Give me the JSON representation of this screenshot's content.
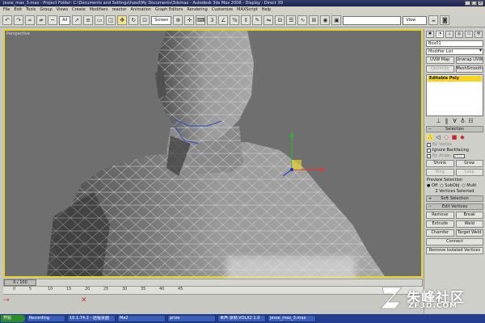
{
  "title": {
    "text": "jesse_max_3.max  - Project Folder: C:\\Documents and Settings\\hasd\\My Documents\\3dsmax  - Autodesk 3ds Max 2008  - Display : Direct 3D"
  },
  "menu": [
    "File",
    "Edit",
    "Tools",
    "Group",
    "Views",
    "Create",
    "Modifiers",
    "reactor",
    "Animation",
    "Graph Editors",
    "Rendering",
    "Customize",
    "MAXScript",
    "Help"
  ],
  "toolbar": {
    "filter_value": "All",
    "refcoord_value": "Screen",
    "view_value": "View"
  },
  "viewport": {
    "label": "Perspective"
  },
  "panel": {
    "object_name": "Box01",
    "modifier_list": "Modifier List",
    "btn_uvw_map": "UVW Map",
    "btn_unwrap_uvw": "Unwrap UVW",
    "btn_optimize": "Optimize",
    "btn_meshsmooth": "MeshSmooth",
    "stack_item": "Editable Poly",
    "rollout_selection": "Selection",
    "chk_by_vertex": "By Vertex",
    "chk_ignore_backfacing": "Ignore Backfacing",
    "chk_by_angle": "By Angle:",
    "angle_value": "45.0",
    "btn_shrink": "Shrink",
    "btn_grow": "Grow",
    "btn_ring": "Ring",
    "btn_loop": "Loop",
    "preview_label": "Preview Selection",
    "radio_off": "Off",
    "radio_subobj": "SubObj",
    "radio_multi": "Multi",
    "selected_status": "2 Vertices Selected",
    "rollout_soft": "Soft Selection",
    "rollout_edit": "Edit Vertices",
    "btn_remove": "Remove",
    "btn_break": "Break",
    "btn_extrude": "Extrude",
    "btn_weld": "Weld",
    "btn_chamfer": "Chamfer",
    "btn_target_weld": "Target Weld",
    "btn_connect": "Connect",
    "btn_remove_isolated": "Remove Isolated Vertices"
  },
  "timeline": {
    "frame": "0 / 100",
    "ticks": [
      "0",
      "5",
      "10",
      "15",
      "20",
      "25",
      "30",
      "35",
      "40",
      "45"
    ]
  },
  "taskbar": {
    "start": "开始",
    "tasks": [
      "Recording",
      "10.1.74.2 - 远程桌面",
      "Ma2",
      "prize",
      "世声.录制.VOLX2 1.0",
      "jesse_max_3.max"
    ]
  },
  "watermark": {
    "title": "朱峰社区",
    "sub": "ZF3D.COM"
  },
  "colors": {
    "viewport_border": "#e6d22e",
    "stack_highlight": "#f7d31e",
    "taskbar": "#253f8f"
  }
}
